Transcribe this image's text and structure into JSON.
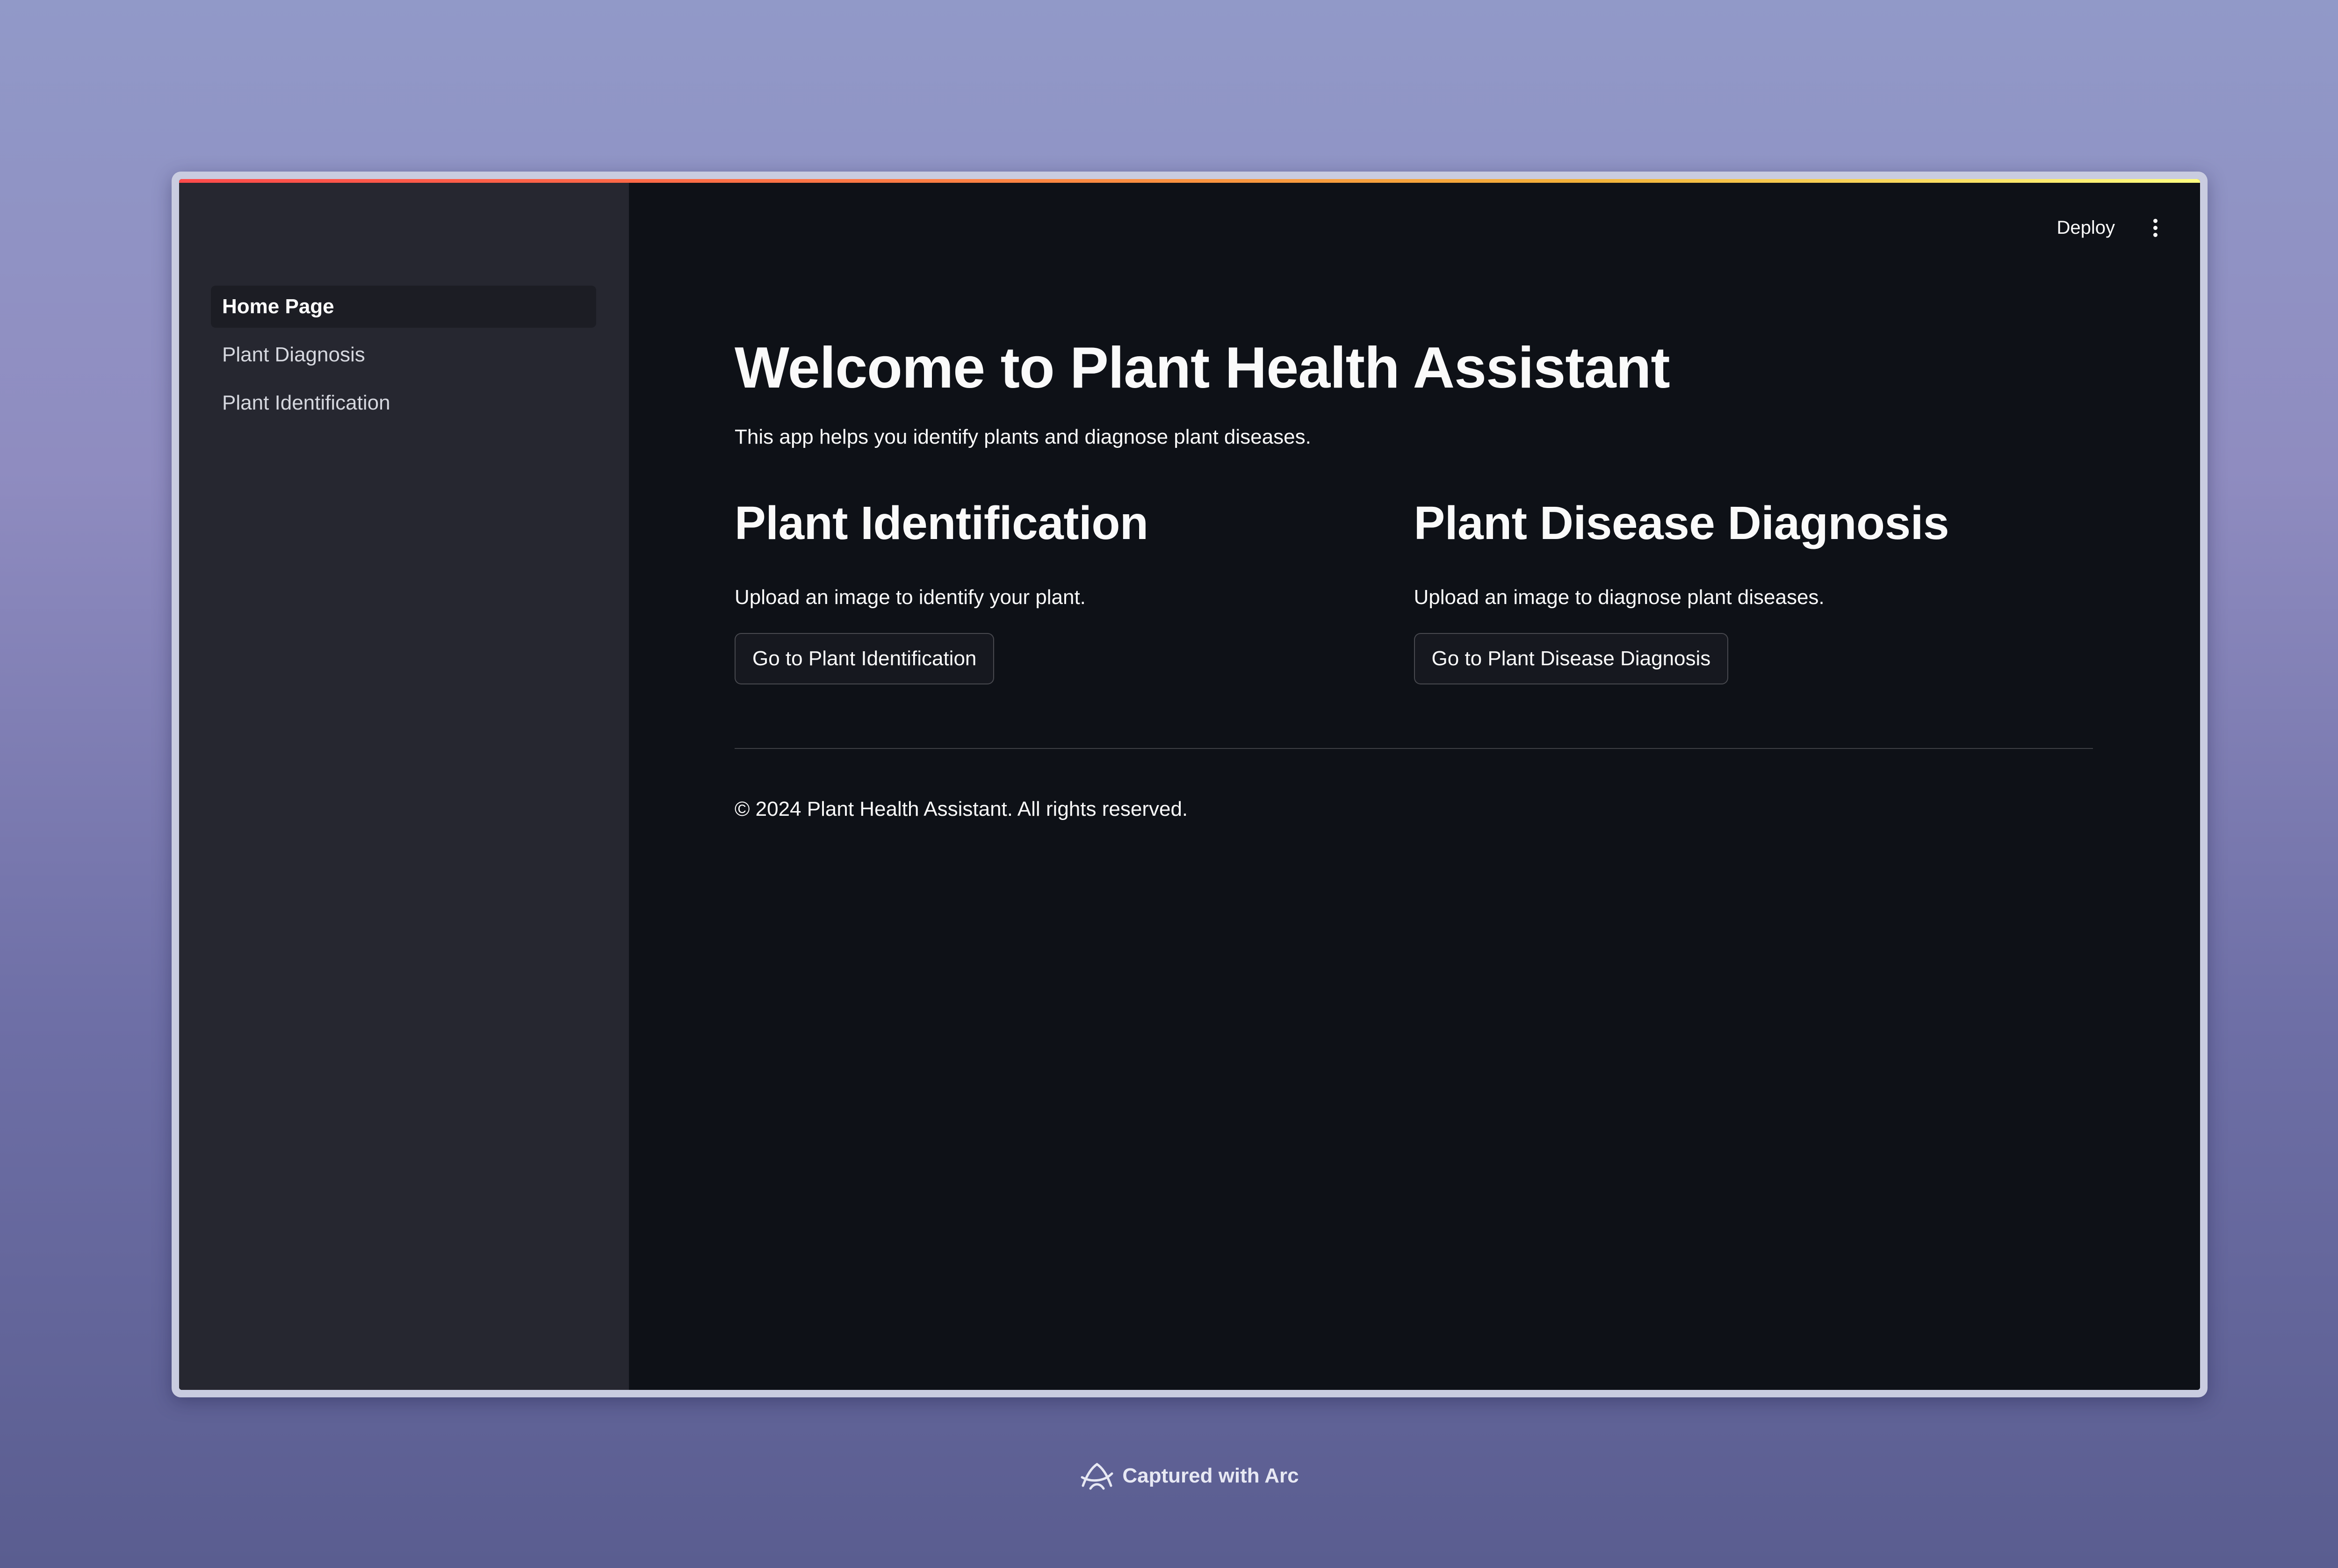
{
  "sidebar": {
    "items": [
      {
        "label": "Home Page",
        "active": true
      },
      {
        "label": "Plant Diagnosis",
        "active": false
      },
      {
        "label": "Plant Identification",
        "active": false
      }
    ]
  },
  "toolbar": {
    "deploy_label": "Deploy",
    "menu_icon": "vertical-ellipsis-icon"
  },
  "main": {
    "title": "Welcome to Plant Health Assistant",
    "intro": "This app helps you identify plants and diagnose plant diseases.",
    "sections": [
      {
        "title": "Plant Identification",
        "description": "Upload an image to identify your plant.",
        "button_label": "Go to Plant Identification"
      },
      {
        "title": "Plant Disease Diagnosis",
        "description": "Upload an image to diagnose plant diseases.",
        "button_label": "Go to Plant Disease Diagnosis"
      }
    ],
    "footer": "© 2024 Plant Health Assistant. All rights reserved."
  },
  "capture_badge": {
    "text": "Captured with Arc",
    "icon": "arc-logo-icon"
  },
  "colors": {
    "app_background": "#0e1117",
    "sidebar_background": "#262730",
    "text": "#fafafa",
    "accent_start": "#ff4b4b",
    "accent_end": "#fffd80"
  }
}
